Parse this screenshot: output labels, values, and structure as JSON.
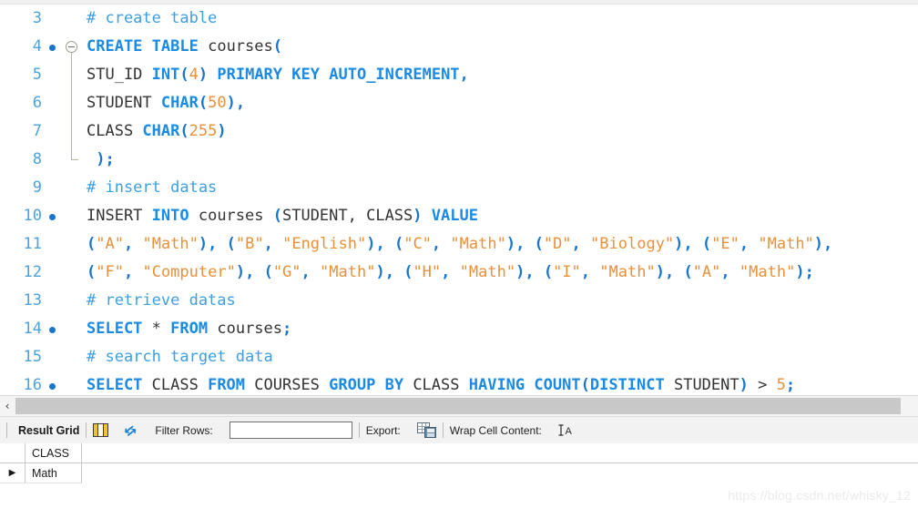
{
  "app": {
    "name": "MySQL Workbench SQL Editor"
  },
  "editor": {
    "first_visible_line": 3,
    "lines": [
      {
        "number": "3",
        "has_breakpoint_dot": false,
        "has_fold_marker": false,
        "text": "# create table",
        "tokens": [
          {
            "t": "# create table",
            "c": "cmt"
          }
        ]
      },
      {
        "number": "4",
        "has_breakpoint_dot": true,
        "has_fold_marker": true,
        "text": "CREATE TABLE courses(",
        "tokens": [
          {
            "t": "CREATE",
            "c": "kw"
          },
          {
            "t": " ",
            "c": "op"
          },
          {
            "t": "TABLE",
            "c": "kw"
          },
          {
            "t": " courses",
            "c": "ident"
          },
          {
            "t": "(",
            "c": "punct"
          }
        ]
      },
      {
        "number": "5",
        "has_breakpoint_dot": false,
        "has_fold_marker": false,
        "text": "STU_ID INT(4) PRIMARY KEY AUTO_INCREMENT,",
        "tokens": [
          {
            "t": "STU_ID ",
            "c": "ident"
          },
          {
            "t": "INT",
            "c": "kw"
          },
          {
            "t": "(",
            "c": "punct"
          },
          {
            "t": "4",
            "c": "num"
          },
          {
            "t": ")",
            "c": "punct"
          },
          {
            "t": " ",
            "c": "op"
          },
          {
            "t": "PRIMARY",
            "c": "kw"
          },
          {
            "t": " ",
            "c": "op"
          },
          {
            "t": "KEY",
            "c": "kw"
          },
          {
            "t": " ",
            "c": "op"
          },
          {
            "t": "AUTO_INCREMENT",
            "c": "kw"
          },
          {
            "t": ",",
            "c": "punct"
          }
        ]
      },
      {
        "number": "6",
        "has_breakpoint_dot": false,
        "has_fold_marker": false,
        "text": "STUDENT CHAR(50),",
        "tokens": [
          {
            "t": "STUDENT ",
            "c": "ident"
          },
          {
            "t": "CHAR",
            "c": "kw"
          },
          {
            "t": "(",
            "c": "punct"
          },
          {
            "t": "50",
            "c": "num"
          },
          {
            "t": ")",
            "c": "punct"
          },
          {
            "t": ",",
            "c": "punct"
          }
        ]
      },
      {
        "number": "7",
        "has_breakpoint_dot": false,
        "has_fold_marker": false,
        "text": "CLASS CHAR(255)",
        "tokens": [
          {
            "t": "CLASS ",
            "c": "ident"
          },
          {
            "t": "CHAR",
            "c": "kw"
          },
          {
            "t": "(",
            "c": "punct"
          },
          {
            "t": "255",
            "c": "num"
          },
          {
            "t": ")",
            "c": "punct"
          }
        ]
      },
      {
        "number": "8",
        "has_breakpoint_dot": false,
        "has_fold_marker": false,
        "text": " );",
        "tokens": [
          {
            "t": " ",
            "c": "op"
          },
          {
            "t": ");",
            "c": "punct"
          }
        ]
      },
      {
        "number": "9",
        "has_breakpoint_dot": false,
        "has_fold_marker": false,
        "text": "# insert datas",
        "tokens": [
          {
            "t": "# insert datas",
            "c": "cmt"
          }
        ]
      },
      {
        "number": "10",
        "has_breakpoint_dot": true,
        "has_fold_marker": false,
        "text": "INSERT INTO courses (STUDENT, CLASS) VALUE",
        "tokens": [
          {
            "t": "INSERT ",
            "c": "ident"
          },
          {
            "t": "INTO",
            "c": "kw"
          },
          {
            "t": " courses ",
            "c": "ident"
          },
          {
            "t": "(",
            "c": "punct"
          },
          {
            "t": "STUDENT, CLASS",
            "c": "ident"
          },
          {
            "t": ")",
            "c": "punct"
          },
          {
            "t": " ",
            "c": "op"
          },
          {
            "t": "VALUE",
            "c": "kw"
          }
        ]
      },
      {
        "number": "11",
        "has_breakpoint_dot": false,
        "has_fold_marker": false,
        "text": "(\"A\", \"Math\"), (\"B\", \"English\"), (\"C\", \"Math\"), (\"D\", \"Biology\"), (\"E\", \"Math\"),",
        "tokens": [
          {
            "t": "(",
            "c": "punct"
          },
          {
            "t": "\"A\"",
            "c": "str"
          },
          {
            "t": ",",
            "c": "punct"
          },
          {
            "t": " ",
            "c": "op"
          },
          {
            "t": "\"Math\"",
            "c": "str"
          },
          {
            "t": "),",
            "c": "punct"
          },
          {
            "t": " ",
            "c": "op"
          },
          {
            "t": "(",
            "c": "punct"
          },
          {
            "t": "\"B\"",
            "c": "str"
          },
          {
            "t": ",",
            "c": "punct"
          },
          {
            "t": " ",
            "c": "op"
          },
          {
            "t": "\"English\"",
            "c": "str"
          },
          {
            "t": "),",
            "c": "punct"
          },
          {
            "t": " ",
            "c": "op"
          },
          {
            "t": "(",
            "c": "punct"
          },
          {
            "t": "\"C\"",
            "c": "str"
          },
          {
            "t": ",",
            "c": "punct"
          },
          {
            "t": " ",
            "c": "op"
          },
          {
            "t": "\"Math\"",
            "c": "str"
          },
          {
            "t": "),",
            "c": "punct"
          },
          {
            "t": " ",
            "c": "op"
          },
          {
            "t": "(",
            "c": "punct"
          },
          {
            "t": "\"D\"",
            "c": "str"
          },
          {
            "t": ",",
            "c": "punct"
          },
          {
            "t": " ",
            "c": "op"
          },
          {
            "t": "\"Biology\"",
            "c": "str"
          },
          {
            "t": "),",
            "c": "punct"
          },
          {
            "t": " ",
            "c": "op"
          },
          {
            "t": "(",
            "c": "punct"
          },
          {
            "t": "\"E\"",
            "c": "str"
          },
          {
            "t": ",",
            "c": "punct"
          },
          {
            "t": " ",
            "c": "op"
          },
          {
            "t": "\"Math\"",
            "c": "str"
          },
          {
            "t": "),",
            "c": "punct"
          }
        ]
      },
      {
        "number": "12",
        "has_breakpoint_dot": false,
        "has_fold_marker": false,
        "text": "(\"F\", \"Computer\"), (\"G\", \"Math\"), (\"H\", \"Math\"), (\"I\", \"Math\"), (\"A\", \"Math\");",
        "tokens": [
          {
            "t": "(",
            "c": "punct"
          },
          {
            "t": "\"F\"",
            "c": "str"
          },
          {
            "t": ",",
            "c": "punct"
          },
          {
            "t": " ",
            "c": "op"
          },
          {
            "t": "\"Computer\"",
            "c": "str"
          },
          {
            "t": "),",
            "c": "punct"
          },
          {
            "t": " ",
            "c": "op"
          },
          {
            "t": "(",
            "c": "punct"
          },
          {
            "t": "\"G\"",
            "c": "str"
          },
          {
            "t": ",",
            "c": "punct"
          },
          {
            "t": " ",
            "c": "op"
          },
          {
            "t": "\"Math\"",
            "c": "str"
          },
          {
            "t": "),",
            "c": "punct"
          },
          {
            "t": " ",
            "c": "op"
          },
          {
            "t": "(",
            "c": "punct"
          },
          {
            "t": "\"H\"",
            "c": "str"
          },
          {
            "t": ",",
            "c": "punct"
          },
          {
            "t": " ",
            "c": "op"
          },
          {
            "t": "\"Math\"",
            "c": "str"
          },
          {
            "t": "),",
            "c": "punct"
          },
          {
            "t": " ",
            "c": "op"
          },
          {
            "t": "(",
            "c": "punct"
          },
          {
            "t": "\"I\"",
            "c": "str"
          },
          {
            "t": ",",
            "c": "punct"
          },
          {
            "t": " ",
            "c": "op"
          },
          {
            "t": "\"Math\"",
            "c": "str"
          },
          {
            "t": "),",
            "c": "punct"
          },
          {
            "t": " ",
            "c": "op"
          },
          {
            "t": "(",
            "c": "punct"
          },
          {
            "t": "\"A\"",
            "c": "str"
          },
          {
            "t": ",",
            "c": "punct"
          },
          {
            "t": " ",
            "c": "op"
          },
          {
            "t": "\"Math\"",
            "c": "str"
          },
          {
            "t": ");",
            "c": "punct"
          }
        ]
      },
      {
        "number": "13",
        "has_breakpoint_dot": false,
        "has_fold_marker": false,
        "text": "# retrieve datas",
        "tokens": [
          {
            "t": "# retrieve datas",
            "c": "cmt"
          }
        ]
      },
      {
        "number": "14",
        "has_breakpoint_dot": true,
        "has_fold_marker": false,
        "text": "SELECT * FROM courses;",
        "tokens": [
          {
            "t": "SELECT",
            "c": "kw"
          },
          {
            "t": " ",
            "c": "op"
          },
          {
            "t": "*",
            "c": "ident"
          },
          {
            "t": " ",
            "c": "op"
          },
          {
            "t": "FROM",
            "c": "kw"
          },
          {
            "t": " courses",
            "c": "ident"
          },
          {
            "t": ";",
            "c": "punct"
          }
        ]
      },
      {
        "number": "15",
        "has_breakpoint_dot": false,
        "has_fold_marker": false,
        "text": "# search target data",
        "tokens": [
          {
            "t": "# search target data",
            "c": "cmt"
          }
        ]
      },
      {
        "number": "16",
        "has_breakpoint_dot": true,
        "has_fold_marker": false,
        "text": "SELECT CLASS FROM COURSES GROUP BY CLASS HAVING COUNT(DISTINCT STUDENT) > 5;",
        "tokens": [
          {
            "t": "SELECT",
            "c": "kw"
          },
          {
            "t": " CLASS ",
            "c": "ident"
          },
          {
            "t": "FROM",
            "c": "kw"
          },
          {
            "t": " COURSES ",
            "c": "ident"
          },
          {
            "t": "GROUP",
            "c": "kw"
          },
          {
            "t": " ",
            "c": "op"
          },
          {
            "t": "BY",
            "c": "kw"
          },
          {
            "t": " CLASS ",
            "c": "ident"
          },
          {
            "t": "HAVING",
            "c": "kw"
          },
          {
            "t": " ",
            "c": "op"
          },
          {
            "t": "COUNT",
            "c": "kw"
          },
          {
            "t": "(",
            "c": "punct"
          },
          {
            "t": "DISTINCT",
            "c": "kw"
          },
          {
            "t": " STUDENT",
            "c": "ident"
          },
          {
            "t": ")",
            "c": "punct"
          },
          {
            "t": " ",
            "c": "op"
          },
          {
            "t": ">",
            "c": "op"
          },
          {
            "t": " ",
            "c": "op"
          },
          {
            "t": "5",
            "c": "num"
          },
          {
            "t": ";",
            "c": "punct"
          }
        ]
      }
    ]
  },
  "scrollbar": {
    "left_arrow_glyph": "‹"
  },
  "result_toolbar": {
    "title": "Result Grid",
    "grid_icon_name": "grid-view-icon",
    "refresh_icon_name": "refresh-icon",
    "refresh_glyph": "⇆",
    "filter_label": "Filter Rows:",
    "filter_value": "",
    "filter_placeholder": "",
    "export_label": "Export:",
    "export_icon_name": "export-recordset-icon",
    "wrap_label": "Wrap Cell Content:",
    "wrap_icon_glyph": "⨏A",
    "wrap_icon_text": "A"
  },
  "result_grid": {
    "columns": [
      "CLASS"
    ],
    "rows": [
      {
        "marker": "▶",
        "cells": [
          "Math"
        ]
      }
    ]
  },
  "watermark": {
    "text": "https://blog.csdn.net/whisky_12"
  }
}
